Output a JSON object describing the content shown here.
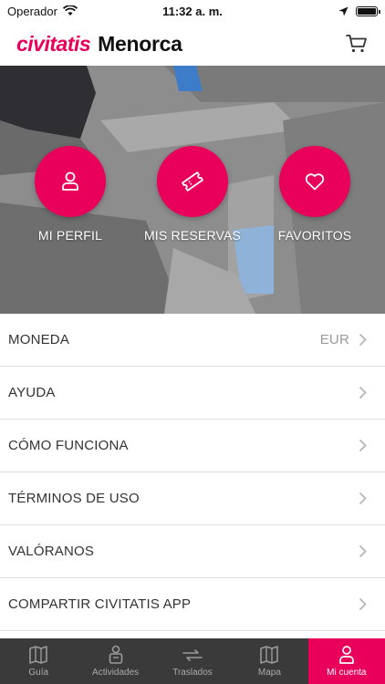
{
  "status_bar": {
    "carrier": "Operador",
    "time": "11:32 a. m."
  },
  "header": {
    "brand": "civitatis",
    "city": "Menorca"
  },
  "hero_actions": [
    {
      "label": "MI PERFIL",
      "icon": "user-icon"
    },
    {
      "label": "MIS RESERVAS",
      "icon": "ticket-icon"
    },
    {
      "label": "FAVORITOS",
      "icon": "heart-icon"
    }
  ],
  "menu": [
    {
      "label": "MONEDA",
      "value": "EUR"
    },
    {
      "label": "AYUDA"
    },
    {
      "label": "CÓMO FUNCIONA"
    },
    {
      "label": "TÉRMINOS DE USO"
    },
    {
      "label": "VALÓRANOS"
    },
    {
      "label": "COMPARTIR CIVITATIS APP"
    }
  ],
  "tabs": [
    {
      "label": "Guía",
      "icon": "guide-icon"
    },
    {
      "label": "Actividades",
      "icon": "activities-icon"
    },
    {
      "label": "Traslados",
      "icon": "transfers-icon"
    },
    {
      "label": "Mapa",
      "icon": "map-icon"
    },
    {
      "label": "Mi cuenta",
      "icon": "account-icon",
      "active": true
    }
  ],
  "colors": {
    "brand": "#e8005a",
    "tab_bar": "#3a3a3a"
  }
}
